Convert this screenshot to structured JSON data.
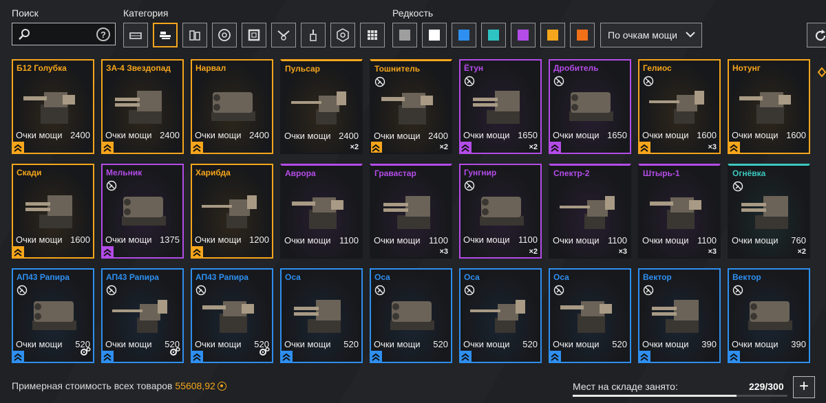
{
  "filters": {
    "search_label": "Поиск",
    "search_value": "",
    "category_label": "Категория",
    "rarity_label": "Редкость",
    "sort_label": "По очкам мощи",
    "categories": [
      {
        "icon": "cabin-icon",
        "selected": false
      },
      {
        "icon": "weapon-icon",
        "selected": true
      },
      {
        "icon": "module-icon",
        "selected": false
      },
      {
        "icon": "wheel-icon",
        "selected": false
      },
      {
        "icon": "frame-icon",
        "selected": false
      },
      {
        "icon": "hardware-icon",
        "selected": false
      },
      {
        "icon": "paint-icon",
        "selected": false
      },
      {
        "icon": "sticker-icon",
        "selected": false
      },
      {
        "icon": "all-icon",
        "selected": false
      }
    ],
    "rarities": [
      {
        "name": "common",
        "color": "#9e9e9e"
      },
      {
        "name": "rare-white",
        "color": "#ffffff"
      },
      {
        "name": "special",
        "color": "#2e8ff0"
      },
      {
        "name": "epic-teal",
        "color": "#2ec4c4"
      },
      {
        "name": "epic",
        "color": "#b44ce8"
      },
      {
        "name": "legendary",
        "color": "#f6a61c"
      },
      {
        "name": "relic",
        "color": "#f07018"
      }
    ]
  },
  "colors": {
    "legendary": "#f6a61c",
    "epic": "#b44ce8",
    "special": "#2e8ff0",
    "teal": "#3cc8c0"
  },
  "power_label": "Очки мощи",
  "items": [
    {
      "name": "Б12 Голубка",
      "power": "2400",
      "rarity": "legendary",
      "badge": true,
      "nocraft": false,
      "qty": "",
      "gear": false,
      "frame": true
    },
    {
      "name": "ЗА-4 Звездопад",
      "power": "2400",
      "rarity": "legendary",
      "badge": true,
      "nocraft": false,
      "qty": "",
      "gear": false,
      "frame": true
    },
    {
      "name": "Нарвал",
      "power": "2400",
      "rarity": "legendary",
      "badge": true,
      "nocraft": false,
      "qty": "",
      "gear": false,
      "frame": true
    },
    {
      "name": "Пульсар",
      "power": "2400",
      "rarity": "legendary",
      "badge": false,
      "nocraft": false,
      "qty": "×2",
      "gear": false,
      "frame": false
    },
    {
      "name": "Тошнитель",
      "power": "2400",
      "rarity": "legendary",
      "badge": true,
      "nocraft": true,
      "qty": "×2",
      "gear": false,
      "frame": false
    },
    {
      "name": "Ётун",
      "power": "1650",
      "rarity": "epic",
      "badge": true,
      "nocraft": true,
      "qty": "×2",
      "gear": false,
      "frame": true
    },
    {
      "name": "Дробитель",
      "power": "1650",
      "rarity": "epic",
      "badge": true,
      "nocraft": true,
      "qty": "",
      "gear": false,
      "frame": true
    },
    {
      "name": "Гелиос",
      "power": "1600",
      "rarity": "legendary",
      "badge": true,
      "nocraft": true,
      "qty": "×3",
      "gear": false,
      "frame": true
    },
    {
      "name": "Нотунг",
      "power": "1600",
      "rarity": "legendary",
      "badge": true,
      "nocraft": false,
      "qty": "",
      "gear": false,
      "frame": true
    },
    {
      "name": "Скади",
      "power": "1600",
      "rarity": "legendary",
      "badge": true,
      "nocraft": false,
      "qty": "",
      "gear": false,
      "frame": true
    },
    {
      "name": "Мельник",
      "power": "1375",
      "rarity": "epic",
      "badge": true,
      "nocraft": true,
      "qty": "",
      "gear": false,
      "frame": true
    },
    {
      "name": "Харибда",
      "power": "1200",
      "rarity": "legendary",
      "badge": true,
      "nocraft": false,
      "qty": "",
      "gear": false,
      "frame": true
    },
    {
      "name": "Аврора",
      "power": "1100",
      "rarity": "epic",
      "badge": false,
      "nocraft": false,
      "qty": "",
      "gear": false,
      "frame": false
    },
    {
      "name": "Гравастар",
      "power": "1100",
      "rarity": "epic",
      "badge": false,
      "nocraft": false,
      "qty": "×3",
      "gear": false,
      "frame": false
    },
    {
      "name": "Гунгнир",
      "power": "1100",
      "rarity": "epic",
      "badge": false,
      "nocraft": true,
      "qty": "×2",
      "gear": false,
      "frame": true
    },
    {
      "name": "Спектр-2",
      "power": "1100",
      "rarity": "epic",
      "badge": false,
      "nocraft": false,
      "qty": "×3",
      "gear": false,
      "frame": false
    },
    {
      "name": "Штырь-1",
      "power": "1100",
      "rarity": "epic",
      "badge": false,
      "nocraft": false,
      "qty": "×3",
      "gear": false,
      "frame": false
    },
    {
      "name": "Огнёвка",
      "power": "760",
      "rarity": "teal",
      "badge": false,
      "nocraft": true,
      "qty": "×2",
      "gear": false,
      "frame": false
    },
    {
      "name": "АП43 Рапира",
      "power": "520",
      "rarity": "special",
      "badge": true,
      "nocraft": true,
      "qty": "",
      "gear": true,
      "frame": true
    },
    {
      "name": "АП43 Рапира",
      "power": "520",
      "rarity": "special",
      "badge": true,
      "nocraft": true,
      "qty": "",
      "gear": true,
      "frame": true
    },
    {
      "name": "АП43 Рапира",
      "power": "520",
      "rarity": "special",
      "badge": true,
      "nocraft": true,
      "qty": "",
      "gear": true,
      "frame": true
    },
    {
      "name": "Оса",
      "power": "520",
      "rarity": "special",
      "badge": true,
      "nocraft": false,
      "qty": "",
      "gear": false,
      "frame": true
    },
    {
      "name": "Оса",
      "power": "520",
      "rarity": "special",
      "badge": true,
      "nocraft": true,
      "qty": "",
      "gear": false,
      "frame": true
    },
    {
      "name": "Оса",
      "power": "520",
      "rarity": "special",
      "badge": true,
      "nocraft": true,
      "qty": "",
      "gear": false,
      "frame": true
    },
    {
      "name": "Оса",
      "power": "520",
      "rarity": "special",
      "badge": true,
      "nocraft": true,
      "qty": "",
      "gear": false,
      "frame": true
    },
    {
      "name": "Вектор",
      "power": "390",
      "rarity": "special",
      "badge": true,
      "nocraft": true,
      "qty": "",
      "gear": false,
      "frame": true
    },
    {
      "name": "Вектор",
      "power": "390",
      "rarity": "special",
      "badge": true,
      "nocraft": true,
      "qty": "",
      "gear": false,
      "frame": true
    }
  ],
  "footer": {
    "cost_label": "Примерная стоимость всех товаров",
    "cost_value": "55608,92",
    "storage_label": "Мест на складе занято:",
    "storage_value": "229/300",
    "storage_fraction": 0.763,
    "add_label": "+"
  }
}
